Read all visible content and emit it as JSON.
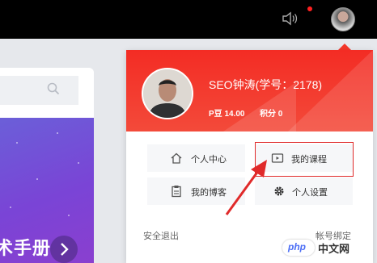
{
  "user": {
    "name": "SEO钟涛(学号：2178)",
    "p_balance": "P豆 14.00",
    "points": "积分 0"
  },
  "menu": {
    "personal_center": "个人中心",
    "my_courses": "我的课程",
    "my_blog": "我的博客",
    "personal_settings": "个人设置"
  },
  "footer": {
    "logout": "安全退出",
    "account_binding": "帐号绑定"
  },
  "banner": {
    "text": "术手册"
  },
  "watermark": {
    "logo": "php",
    "text": "中文网"
  },
  "icons": {
    "sound": "sound-icon",
    "search": "search-icon",
    "home": "home-icon",
    "video": "video-icon",
    "clipboard": "clipboard-icon",
    "gear": "gear-icon",
    "next": "chevron-right-icon"
  },
  "colors": {
    "header_red": "#f32c24",
    "highlight_border": "#e02a2a",
    "banner_purple": "#7a44d6"
  }
}
